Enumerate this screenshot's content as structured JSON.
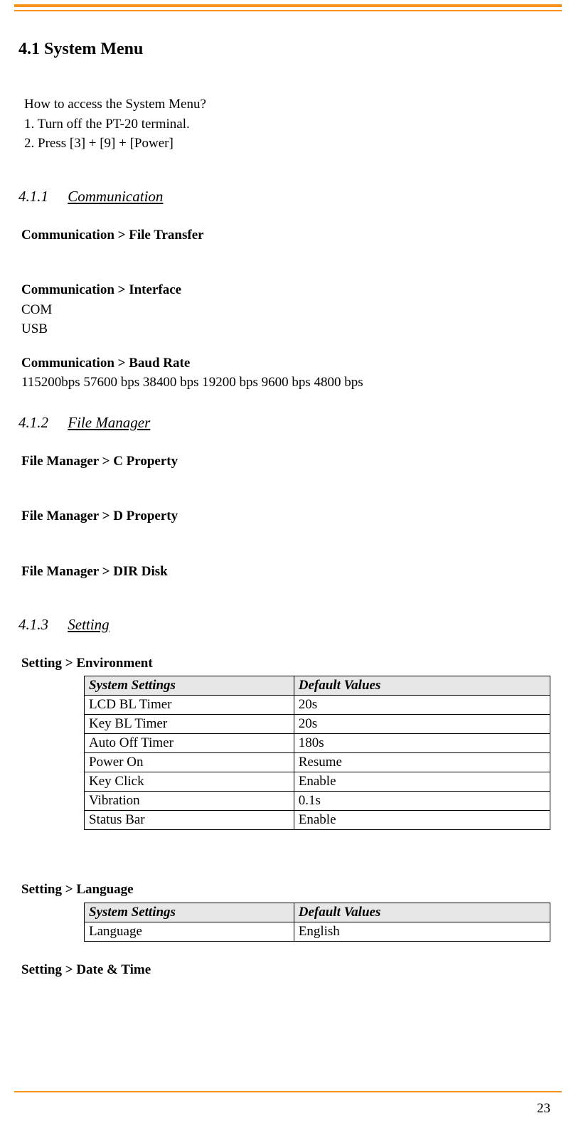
{
  "page_number": "23",
  "section_title": "4.1  System Menu",
  "intro": {
    "q": "How to access the System Menu?",
    "s1": "1. Turn off the PT-20 terminal.",
    "s2": "2. Press [3] + [9] + [Power]"
  },
  "s411": {
    "num": "4.1.1",
    "title": "Communication"
  },
  "comm": {
    "file_transfer": "Communication > File Transfer",
    "interface_title": "Communication > Interface",
    "iface1": "COM",
    "iface2": "USB",
    "baud_title": "Communication > Baud Rate",
    "baud_values": "115200bps 57600 bps 38400 bps 19200 bps 9600 bps 4800 bps"
  },
  "s412": {
    "num": "4.1.2",
    "title": "File Manager"
  },
  "fm": {
    "c": "File Manager > C Property",
    "d": "File Manager > D Property",
    "dir": "File Manager > DIR Disk"
  },
  "s413": {
    "num": "4.1.3",
    "title": "Setting"
  },
  "setting_env_title": "Setting > Environment",
  "table_headers": {
    "col1": "System Settings",
    "col2": "Default Values"
  },
  "env_rows": [
    {
      "k": "LCD BL Timer",
      "v": "20s"
    },
    {
      "k": "Key BL Timer",
      "v": "20s"
    },
    {
      "k": "Auto Off Timer",
      "v": "180s"
    },
    {
      "k": "Power On",
      "v": "Resume"
    },
    {
      "k": "Key Click",
      "v": "Enable"
    },
    {
      "k": "Vibration",
      "v": "0.1s"
    },
    {
      "k": "Status Bar",
      "v": "Enable"
    }
  ],
  "setting_lang_title": "Setting > Language",
  "lang_rows": [
    {
      "k": "Language",
      "v": "English"
    }
  ],
  "setting_datetime_title": "Setting > Date & Time"
}
